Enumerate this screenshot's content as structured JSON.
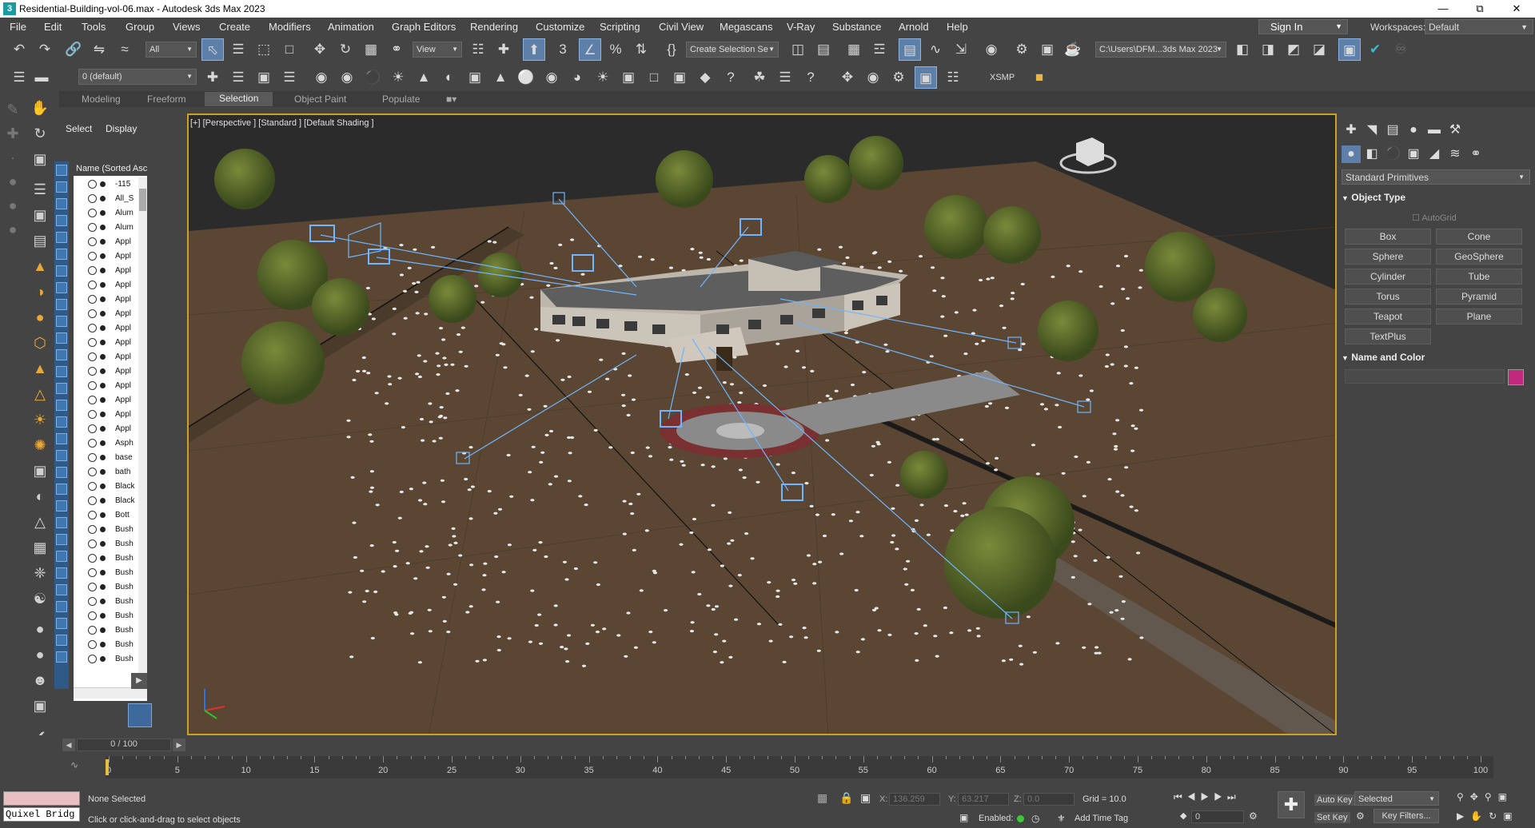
{
  "window": {
    "title": "Residential-Building-vol-06.max - Autodesk 3ds Max 2023",
    "app_icon": "3"
  },
  "menu": [
    "File",
    "Edit",
    "Tools",
    "Group",
    "Views",
    "Create",
    "Modifiers",
    "Animation",
    "Graph Editors",
    "Rendering",
    "Customize",
    "Scripting",
    "Civil View",
    "Megascans",
    "V-Ray",
    "Substance",
    "Arnold",
    "Help"
  ],
  "signin": "Sign In",
  "workspace": {
    "label": "Workspaces:",
    "value": "Default"
  },
  "toolbar": {
    "filter": "All",
    "ref_coord": "View",
    "selection_set": "Create Selection Se",
    "project_path": "C:\\Users\\DFM...3ds Max 2023",
    "layer": "0 (default)",
    "xsmp": "XSMP"
  },
  "ribbon": {
    "tabs": [
      "Modeling",
      "Freeform",
      "Selection",
      "Object Paint",
      "Populate"
    ],
    "active": "Selection"
  },
  "scene_explorer": {
    "tabs": [
      "Select",
      "Display"
    ],
    "header": "Name (Sorted Asce",
    "rows": [
      "-115",
      "All_S",
      "Alum",
      "Alum",
      "Appl",
      "Appl",
      "Appl",
      "Appl",
      "Appl",
      "Appl",
      "Appl",
      "Appl",
      "Appl",
      "Appl",
      "Appl",
      "Appl",
      "Appl",
      "Appl",
      "Asph",
      "base",
      "bath",
      "Black",
      "Black",
      "Bott",
      "Bush",
      "Bush",
      "Bush",
      "Bush",
      "Bush",
      "Bush",
      "Bush",
      "Bush",
      "Bush",
      "Bush"
    ]
  },
  "viewport": {
    "label": "[+] [Perspective ] [Standard ] [Default Shading ]",
    "border_color": "#c9a227"
  },
  "command_panel": {
    "category": "Standard Primitives",
    "object_type_title": "Object Type",
    "autogrid": "AutoGrid",
    "buttons": [
      "Box",
      "Cone",
      "Sphere",
      "GeoSphere",
      "Cylinder",
      "Tube",
      "Torus",
      "Pyramid",
      "Teapot",
      "Plane",
      "TextPlus"
    ],
    "name_color_title": "Name and Color",
    "object_color": "#c2287e"
  },
  "timeline": {
    "frame": "0 / 100",
    "ticks": [
      "0",
      "5",
      "10",
      "15",
      "20",
      "25",
      "30",
      "35",
      "40",
      "45",
      "50",
      "55",
      "60",
      "65",
      "70",
      "75",
      "80",
      "85",
      "90",
      "95",
      "100"
    ]
  },
  "status": {
    "quixel": "Quixel Bridg",
    "selection": "None Selected",
    "prompt": "Click or click-and-drag to select objects",
    "x_label": "X:",
    "x": "136.259",
    "y_label": "Y:",
    "y": "63.217",
    "z_label": "Z:",
    "z": "0.0",
    "grid": "Grid = 10.0",
    "enabled": "Enabled:",
    "add_time_tag": "Add Time Tag",
    "auto_key": "Auto Key",
    "set_key": "Set Key",
    "key_mode": "Selected",
    "key_filters": "Key Filters...",
    "frame_field": "0"
  }
}
